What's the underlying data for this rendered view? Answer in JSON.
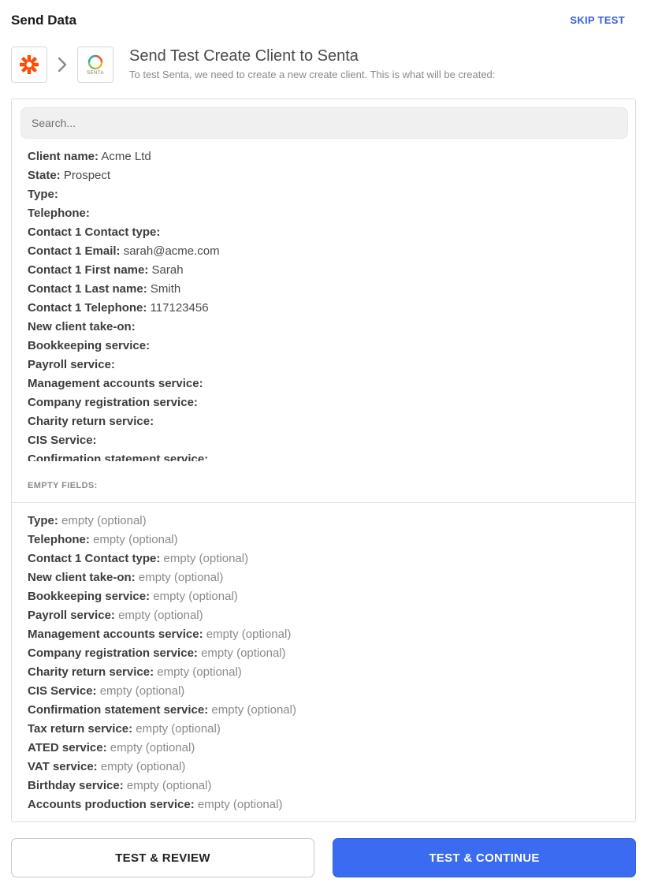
{
  "header": {
    "title": "Send Data",
    "skip_label": "SKIP TEST"
  },
  "step": {
    "title": "Send Test Create Client to Senta",
    "subtitle": "To test Senta, we need to create a new create client. This is what will be created:",
    "senta_logo_text": "SENTA"
  },
  "icons": {
    "zapier": "zapier-asterisk-icon",
    "chevron": "chevron-right-icon",
    "senta": "senta-logo-icon",
    "zapier_color": "#ff4a00"
  },
  "search": {
    "placeholder": "Search..."
  },
  "fields": [
    {
      "label": "Client name:",
      "value": "Acme Ltd"
    },
    {
      "label": "State:",
      "value": "Prospect"
    },
    {
      "label": "Type:",
      "value": ""
    },
    {
      "label": "Telephone:",
      "value": ""
    },
    {
      "label": "Contact 1 Contact type:",
      "value": ""
    },
    {
      "label": "Contact 1 Email:",
      "value": "sarah@acme.com"
    },
    {
      "label": "Contact 1 First name:",
      "value": "Sarah"
    },
    {
      "label": "Contact 1 Last name:",
      "value": "Smith"
    },
    {
      "label": "Contact 1 Telephone:",
      "value": "117123456"
    },
    {
      "label": "New client take-on:",
      "value": ""
    },
    {
      "label": "Bookkeeping service:",
      "value": ""
    },
    {
      "label": "Payroll service:",
      "value": ""
    },
    {
      "label": "Management accounts service:",
      "value": ""
    },
    {
      "label": "Company registration service:",
      "value": ""
    },
    {
      "label": "Charity return service:",
      "value": ""
    },
    {
      "label": "CIS Service:",
      "value": ""
    },
    {
      "label": "Confirmation statement service:",
      "value": ""
    }
  ],
  "empty_section": {
    "title": "EMPTY FIELDS:",
    "items": [
      {
        "label": "Type:",
        "value": "empty (optional)"
      },
      {
        "label": "Telephone:",
        "value": "empty (optional)"
      },
      {
        "label": "Contact 1 Contact type:",
        "value": "empty (optional)"
      },
      {
        "label": "New client take-on:",
        "value": "empty (optional)"
      },
      {
        "label": "Bookkeeping service:",
        "value": "empty (optional)"
      },
      {
        "label": "Payroll service:",
        "value": "empty (optional)"
      },
      {
        "label": "Management accounts service:",
        "value": "empty (optional)"
      },
      {
        "label": "Company registration service:",
        "value": "empty (optional)"
      },
      {
        "label": "Charity return service:",
        "value": "empty (optional)"
      },
      {
        "label": "CIS Service:",
        "value": "empty (optional)"
      },
      {
        "label": "Confirmation statement service:",
        "value": "empty (optional)"
      },
      {
        "label": "Tax return service:",
        "value": "empty (optional)"
      },
      {
        "label": "ATED service:",
        "value": "empty (optional)"
      },
      {
        "label": "VAT service:",
        "value": "empty (optional)"
      },
      {
        "label": "Birthday service:",
        "value": "empty (optional)"
      },
      {
        "label": "Accounts production service:",
        "value": "empty (optional)"
      }
    ]
  },
  "buttons": {
    "review_label": "TEST & REVIEW",
    "continue_label": "TEST & CONTINUE"
  },
  "colors": {
    "accent": "#3a6bf0",
    "link": "#3461d8"
  }
}
